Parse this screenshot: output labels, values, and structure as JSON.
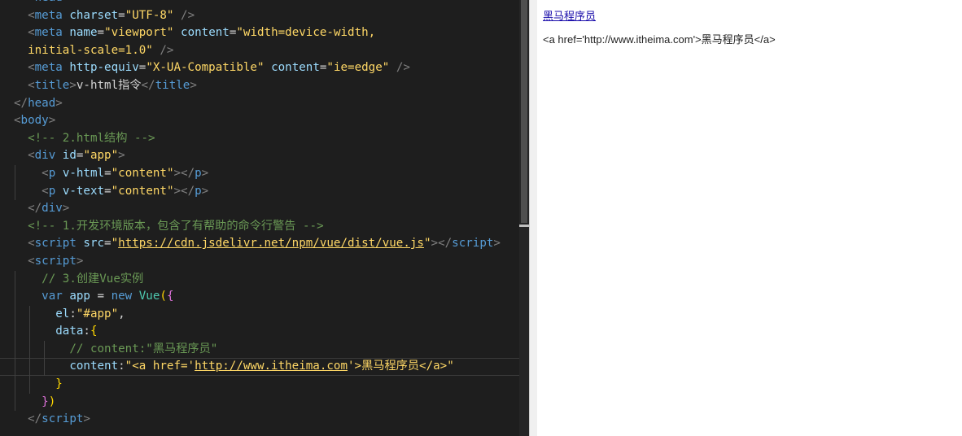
{
  "editor": {
    "lines": [
      [
        {
          "c": "c-punct",
          "t": "  <"
        },
        {
          "c": "c-tag",
          "t": "head"
        },
        {
          "c": "c-punct",
          "t": ">"
        }
      ],
      [
        {
          "c": "c-punct",
          "t": "  <"
        },
        {
          "c": "c-tag",
          "t": "meta"
        },
        {
          "c": "c-text",
          "t": " "
        },
        {
          "c": "c-attr",
          "t": "charset"
        },
        {
          "c": "c-eq",
          "t": "="
        },
        {
          "c": "c-strb",
          "t": "\"UTF-8\""
        },
        {
          "c": "c-punct",
          "t": " />"
        }
      ],
      [
        {
          "c": "c-punct",
          "t": "  <"
        },
        {
          "c": "c-tag",
          "t": "meta"
        },
        {
          "c": "c-text",
          "t": " "
        },
        {
          "c": "c-attr",
          "t": "name"
        },
        {
          "c": "c-eq",
          "t": "="
        },
        {
          "c": "c-strb",
          "t": "\"viewport\""
        },
        {
          "c": "c-text",
          "t": " "
        },
        {
          "c": "c-attr",
          "t": "content"
        },
        {
          "c": "c-eq",
          "t": "="
        },
        {
          "c": "c-strb",
          "t": "\"width=device-width,"
        }
      ],
      [
        {
          "c": "c-strb",
          "t": "  initial-scale=1.0\""
        },
        {
          "c": "c-punct",
          "t": " />"
        }
      ],
      [
        {
          "c": "c-punct",
          "t": "  <"
        },
        {
          "c": "c-tag",
          "t": "meta"
        },
        {
          "c": "c-text",
          "t": " "
        },
        {
          "c": "c-attr",
          "t": "http-equiv"
        },
        {
          "c": "c-eq",
          "t": "="
        },
        {
          "c": "c-strb",
          "t": "\"X-UA-Compatible\""
        },
        {
          "c": "c-text",
          "t": " "
        },
        {
          "c": "c-attr",
          "t": "content"
        },
        {
          "c": "c-eq",
          "t": "="
        },
        {
          "c": "c-strb",
          "t": "\"ie=edge\""
        },
        {
          "c": "c-punct",
          "t": " />"
        }
      ],
      [
        {
          "c": "c-punct",
          "t": "  <"
        },
        {
          "c": "c-tag",
          "t": "title"
        },
        {
          "c": "c-punct",
          "t": ">"
        },
        {
          "c": "c-text",
          "t": "v-html指令"
        },
        {
          "c": "c-punct",
          "t": "</"
        },
        {
          "c": "c-tag",
          "t": "title"
        },
        {
          "c": "c-punct",
          "t": ">"
        }
      ],
      [
        {
          "c": "c-punct",
          "t": "</"
        },
        {
          "c": "c-tag",
          "t": "head"
        },
        {
          "c": "c-punct",
          "t": ">"
        }
      ],
      [
        {
          "c": "c-punct",
          "t": "<"
        },
        {
          "c": "c-tag",
          "t": "body"
        },
        {
          "c": "c-punct",
          "t": ">"
        }
      ],
      [
        {
          "c": "c-comment",
          "t": "  <!-- 2.html结构 -->"
        }
      ],
      [
        {
          "c": "c-punct",
          "t": "  <"
        },
        {
          "c": "c-tag",
          "t": "div"
        },
        {
          "c": "c-text",
          "t": " "
        },
        {
          "c": "c-attr",
          "t": "id"
        },
        {
          "c": "c-eq",
          "t": "="
        },
        {
          "c": "c-strb",
          "t": "\"app\""
        },
        {
          "c": "c-punct",
          "t": ">"
        }
      ],
      [
        {
          "c": "c-punct",
          "t": "    <"
        },
        {
          "c": "c-tag",
          "t": "p"
        },
        {
          "c": "c-text",
          "t": " "
        },
        {
          "c": "c-attr",
          "t": "v-html"
        },
        {
          "c": "c-eq",
          "t": "="
        },
        {
          "c": "c-strb",
          "t": "\"content\""
        },
        {
          "c": "c-punct",
          "t": "></"
        },
        {
          "c": "c-tag",
          "t": "p"
        },
        {
          "c": "c-punct",
          "t": ">"
        }
      ],
      [
        {
          "c": "c-punct",
          "t": "    <"
        },
        {
          "c": "c-tag",
          "t": "p"
        },
        {
          "c": "c-text",
          "t": " "
        },
        {
          "c": "c-attr",
          "t": "v-text"
        },
        {
          "c": "c-eq",
          "t": "="
        },
        {
          "c": "c-strb",
          "t": "\"content\""
        },
        {
          "c": "c-punct",
          "t": "></"
        },
        {
          "c": "c-tag",
          "t": "p"
        },
        {
          "c": "c-punct",
          "t": ">"
        }
      ],
      [
        {
          "c": "c-punct",
          "t": "  </"
        },
        {
          "c": "c-tag",
          "t": "div"
        },
        {
          "c": "c-punct",
          "t": ">"
        }
      ],
      [
        {
          "c": "c-comment",
          "t": "  <!-- 1.开发环境版本，包含了有帮助的命令行警告 -->"
        }
      ],
      [
        {
          "c": "c-punct",
          "t": "  <"
        },
        {
          "c": "c-tag",
          "t": "script"
        },
        {
          "c": "c-text",
          "t": " "
        },
        {
          "c": "c-attr",
          "t": "src"
        },
        {
          "c": "c-eq",
          "t": "="
        },
        {
          "c": "c-strb",
          "t": "\""
        },
        {
          "c": "c-url",
          "t": "https://cdn.jsdelivr.net/npm/vue/dist/vue.js"
        },
        {
          "c": "c-strb",
          "t": "\""
        },
        {
          "c": "c-punct",
          "t": "></"
        },
        {
          "c": "c-tag",
          "t": "script"
        },
        {
          "c": "c-punct",
          "t": ">"
        }
      ],
      [
        {
          "c": "c-punct",
          "t": "  <"
        },
        {
          "c": "c-tag",
          "t": "script"
        },
        {
          "c": "c-punct",
          "t": ">"
        }
      ],
      [
        {
          "c": "c-comment",
          "t": "    // 3.创建Vue实例"
        }
      ],
      [
        {
          "c": "c-kw",
          "t": "    var"
        },
        {
          "c": "c-text",
          "t": " "
        },
        {
          "c": "c-key",
          "t": "app"
        },
        {
          "c": "c-text",
          "t": " = "
        },
        {
          "c": "c-kw",
          "t": "new"
        },
        {
          "c": "c-text",
          "t": " "
        },
        {
          "c": "c-class",
          "t": "Vue"
        },
        {
          "c": "c-brace",
          "t": "("
        },
        {
          "c": "c-brace2",
          "t": "{"
        }
      ],
      [
        {
          "c": "c-key",
          "t": "      el"
        },
        {
          "c": "c-text",
          "t": ":"
        },
        {
          "c": "c-strb",
          "t": "\"#app\""
        },
        {
          "c": "c-text",
          "t": ","
        }
      ],
      [
        {
          "c": "c-key",
          "t": "      data"
        },
        {
          "c": "c-text",
          "t": ":"
        },
        {
          "c": "c-brace",
          "t": "{"
        }
      ],
      [
        {
          "c": "c-comment",
          "t": "        // content:\"黑马程序员\""
        }
      ],
      [
        {
          "c": "c-key",
          "t": "        content"
        },
        {
          "c": "c-text",
          "t": ":"
        },
        {
          "c": "c-strb",
          "t": "\"<a href='"
        },
        {
          "c": "c-url",
          "t": "http://www.itheima.com"
        },
        {
          "c": "c-strb",
          "t": "'>黑马程序员</a>\""
        }
      ],
      [
        {
          "c": "c-brace",
          "t": "      }"
        }
      ],
      [
        {
          "c": "c-brace2",
          "t": "    }"
        },
        {
          "c": "c-brace",
          "t": ")"
        }
      ],
      [
        {
          "c": "c-punct",
          "t": "  </"
        },
        {
          "c": "c-tag",
          "t": "script"
        },
        {
          "c": "c-punct",
          "t": ">"
        }
      ]
    ],
    "active_line": 21
  },
  "preview": {
    "link_text": "黑马程序员",
    "raw_text": "<a href='http://www.itheima.com'>黑马程序员</a>"
  }
}
